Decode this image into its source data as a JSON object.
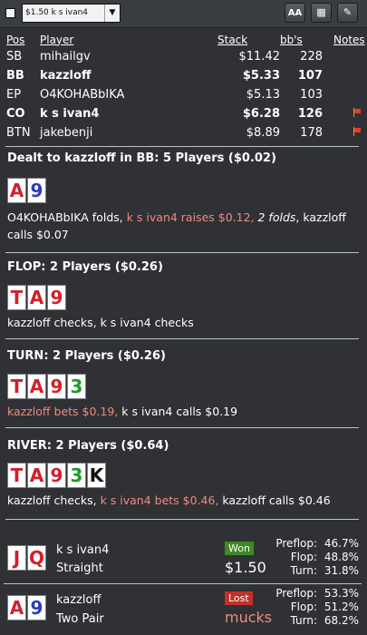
{
  "toolbar": {
    "select_value": "$1.50 k s ivan4",
    "font_btn": "AA",
    "grid_btn": "▦",
    "edit_btn": "✎"
  },
  "headers": {
    "pos": "Pos",
    "player": "Player",
    "stack": "Stack",
    "bbs": "bb's",
    "notes": "Notes"
  },
  "players": [
    {
      "pos": "SB",
      "name": "mihailgv",
      "stack": "$11.42",
      "bbs": "228",
      "bold": false,
      "flag": false
    },
    {
      "pos": "BB",
      "name": "kazzloff",
      "stack": "$5.33",
      "bbs": "107",
      "bold": true,
      "flag": false
    },
    {
      "pos": "EP",
      "name": "O4KOHABbIKA",
      "stack": "$5.13",
      "bbs": "103",
      "bold": false,
      "flag": false
    },
    {
      "pos": "CO",
      "name": "k s ivan4",
      "stack": "$6.28",
      "bbs": "126",
      "bold": true,
      "flag": true
    },
    {
      "pos": "BTN",
      "name": "jakebenji",
      "stack": "$8.89",
      "bbs": "178",
      "bold": false,
      "flag": true
    }
  ],
  "preflop": {
    "title": "Dealt to kazzloff in BB: 5 Players ($0.02)",
    "cards": [
      {
        "rank": "A",
        "color": "red"
      },
      {
        "rank": "9",
        "color": "blue"
      }
    ],
    "a1": "O4KOHABbIKA folds, ",
    "a2": "k s ivan4 raises $0.12,",
    "a3": " ",
    "a4": "2 folds",
    "a5": ", kazzloff calls $0.07"
  },
  "flop": {
    "title": "FLOP: 2 Players ($0.26)",
    "cards": [
      {
        "rank": "T",
        "color": "red"
      },
      {
        "rank": "A",
        "color": "red"
      },
      {
        "rank": "9",
        "color": "red"
      }
    ],
    "action": "kazzloff checks, k s ivan4 checks"
  },
  "turn": {
    "title": "TURN: 2 Players ($0.26)",
    "cards": [
      {
        "rank": "T",
        "color": "red"
      },
      {
        "rank": "A",
        "color": "red"
      },
      {
        "rank": "9",
        "color": "red"
      },
      {
        "rank": "3",
        "color": "green"
      }
    ],
    "a1": "kazzloff bets $0.19,",
    "a2": " k s ivan4 calls $0.19"
  },
  "river": {
    "title": "RIVER: 2 Players ($0.64)",
    "cards": [
      {
        "rank": "T",
        "color": "red"
      },
      {
        "rank": "A",
        "color": "red"
      },
      {
        "rank": "9",
        "color": "red"
      },
      {
        "rank": "3",
        "color": "green"
      },
      {
        "rank": "K",
        "color": "black"
      }
    ],
    "a1": "kazzloff checks, ",
    "a2": "k s ivan4 bets $0.46,",
    "a3": " kazzloff calls $0.46"
  },
  "results": [
    {
      "cards": [
        {
          "rank": "J",
          "color": "red"
        },
        {
          "rank": "Q",
          "color": "red"
        }
      ],
      "name": "k s ivan4",
      "hand": "Straight",
      "badge": "Won",
      "badge_color": "#3e8a22",
      "amount": "$1.50",
      "amount_color": "#ffffff",
      "stats": [
        {
          "label": "Preflop:",
          "value": "46.7%"
        },
        {
          "label": "Flop:",
          "value": "48.8%"
        },
        {
          "label": "Turn:",
          "value": "31.8%"
        }
      ]
    },
    {
      "cards": [
        {
          "rank": "A",
          "color": "red"
        },
        {
          "rank": "9",
          "color": "blue"
        }
      ],
      "name": "kazzloff",
      "hand": "Two Pair",
      "badge": "Lost",
      "badge_color": "#c2302a",
      "amount": "mucks",
      "amount_color": "#f08a80",
      "stats": [
        {
          "label": "Preflop:",
          "value": "53.3%"
        },
        {
          "label": "Flop:",
          "value": "51.2%"
        },
        {
          "label": "Turn:",
          "value": "68.2%"
        }
      ]
    }
  ]
}
